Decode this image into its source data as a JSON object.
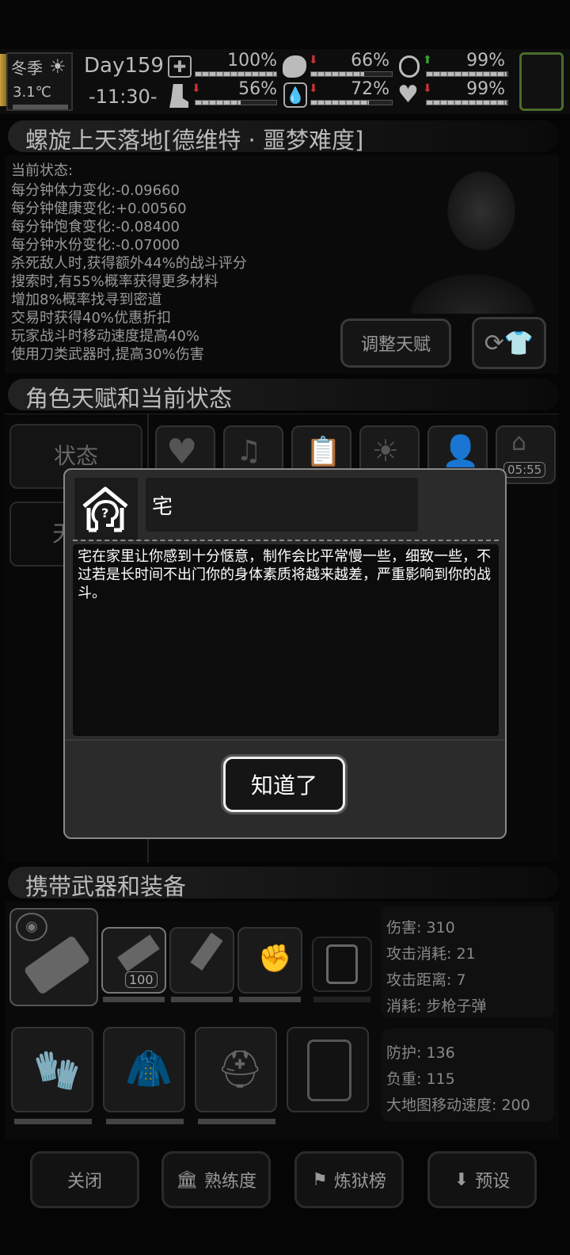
{
  "hud": {
    "season": "冬季",
    "temperature": "3.1℃",
    "day": "Day159",
    "time": "-11:30-",
    "stats": [
      {
        "icon": "medkit",
        "value": "100%",
        "fill": 1.0
      },
      {
        "icon": "stomach",
        "value": "66%",
        "fill": 0.66
      },
      {
        "icon": "pill",
        "value": "99%",
        "fill": 0.99
      },
      {
        "icon": "boot",
        "value": "56%",
        "fill": 0.56
      },
      {
        "icon": "water-drop",
        "value": "72%",
        "fill": 0.72
      },
      {
        "icon": "heart",
        "value": "99%",
        "fill": 0.99
      }
    ]
  },
  "character": {
    "title": "螺旋上天落地[德维特 · 噩梦难度]",
    "status_header": "当前状态:",
    "status_lines": [
      "每分钟体力变化:-0.09660",
      "每分钟健康变化:+0.00560",
      "每分钟饱食变化:-0.08400",
      "每分钟水份变化:-0.07000",
      "杀死敌人时,获得额外44%的战斗评分",
      "搜索时,有55%概率获得更多材料",
      "增加8%概率找寻到密道",
      "交易时获得40%优惠折扣",
      "玩家战斗时移动速度提高40%",
      "使用刀类武器时,提高30%伤害"
    ],
    "adjust_talent_label": "调整天赋"
  },
  "talents_section": {
    "title": "角色天赋和当前状态",
    "tab_status": "状态",
    "tab_talent": "天",
    "badge_timer": "05:55"
  },
  "dialog": {
    "title": "宅",
    "description": "宅在家里让你感到十分惬意，制作会比平常慢一些，细致一些，不过若是长时间不出门你的身体素质将越来越差，严重影响到你的战斗。",
    "confirm_label": "知道了"
  },
  "equipment": {
    "title": "携带武器和装备",
    "ammo_count": "100",
    "weapon_stats": [
      "伤害: 310",
      "攻击消耗: 21",
      "攻击距离: 7",
      "消耗: 步枪子弹"
    ],
    "armor_stats": [
      "防护: 136",
      "负重: 115",
      "大地图移动速度: 200"
    ]
  },
  "bottom": {
    "close": "关闭",
    "proficiency": "熟练度",
    "ranking": "炼狱榜",
    "preset": "预设"
  }
}
